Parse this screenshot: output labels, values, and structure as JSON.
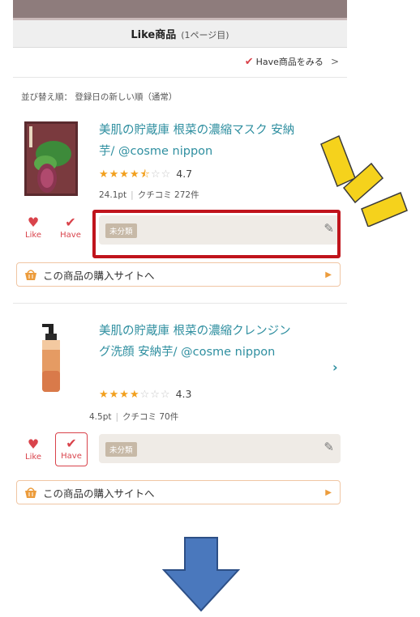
{
  "header": {
    "title": "Like商品",
    "subtitle": "(1ページ目)"
  },
  "have_link": {
    "label": "Have商品をみる"
  },
  "sort": {
    "label": "並び替え順：",
    "value": "登録日の新しい順（通常）"
  },
  "products": [
    {
      "title": "美肌の貯蔵庫 根菜の濃縮マスク 安納芋",
      "brand": "/ @cosme nippon",
      "stars_filled": "★★★★⯪",
      "stars_empty": "☆☆",
      "rating": "4.7",
      "points": "24.1pt",
      "reviews": "クチコミ 272件",
      "like_label": "Like",
      "have_label": "Have",
      "memo_tag": "未分類",
      "buy_label": "この商品の購入サイトへ"
    },
    {
      "title": "美肌の貯蔵庫 根菜の濃縮クレンジング洗顔 安納芋",
      "brand": "/ @cosme nippon",
      "stars_filled": "★★★★",
      "stars_empty": "☆☆☆",
      "rating": "4.3",
      "points": "4.5pt",
      "reviews": "クチコミ 70件",
      "like_label": "Like",
      "have_label": "Have",
      "memo_tag": "未分類",
      "buy_label": "この商品の購入サイトへ"
    }
  ],
  "colors": {
    "accent_teal": "#2f8fa0",
    "like_red": "#d9434b",
    "highlight": "#c0141c",
    "star": "#f2a01e",
    "arrow": "#4a78bd",
    "sparkle": "#f5d21c"
  }
}
